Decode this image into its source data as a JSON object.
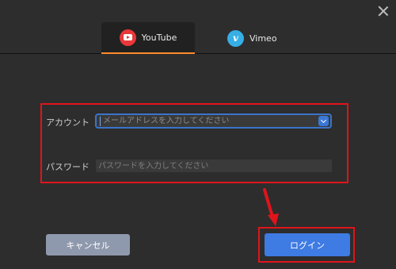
{
  "tabs": [
    {
      "label": "YouTube",
      "icon": "youtube-icon",
      "active": true
    },
    {
      "label": "Vimeo",
      "icon": "vimeo-icon",
      "active": false
    }
  ],
  "form": {
    "account_label": "アカウント",
    "account_placeholder": "メールアドレスを入力してください",
    "password_label": "パスワード",
    "password_placeholder": "パスワードを入力してください"
  },
  "buttons": {
    "cancel": "キャンセル",
    "login": "ログイン"
  },
  "colors": {
    "background": "#2d2d2d",
    "active_tab_underline": "#ff8a2a",
    "highlight": "#e0141b",
    "login_button": "#3e7be2",
    "cancel_button": "#8f99ad"
  }
}
